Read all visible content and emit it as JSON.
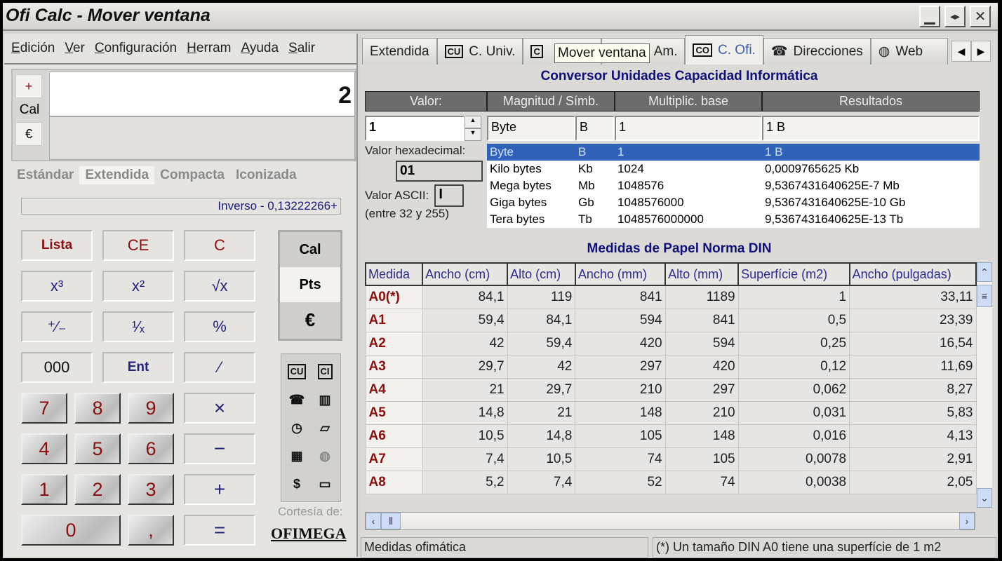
{
  "window": {
    "title": "Ofi Calc - Mover ventana",
    "controls": [
      "minimize",
      "restore",
      "close"
    ]
  },
  "menu": [
    {
      "label": "Edición",
      "key": "E"
    },
    {
      "label": "Ver",
      "key": "V"
    },
    {
      "label": "Configuración",
      "key": "C"
    },
    {
      "label": "Herram",
      "key": "H"
    },
    {
      "label": "Ayuda",
      "key": "A"
    },
    {
      "label": "Salir",
      "key": "S"
    }
  ],
  "calc": {
    "side": {
      "plus": "+",
      "cal": "Cal",
      "euro": "€"
    },
    "display": "2",
    "modes": [
      "Estándar",
      "Extendida",
      "Compacta",
      "Iconizada"
    ],
    "active_mode": "Extendida",
    "inverse": "Inverso - 0,13222266+",
    "func_keys": [
      "Lista",
      "CE",
      "C",
      "x³",
      "x²",
      "√x",
      "⁺∕₋",
      "¹∕ₓ",
      "%",
      "000",
      "Ent",
      "⁄"
    ],
    "ops": [
      "×",
      "−",
      "+",
      "="
    ],
    "digits": [
      "7",
      "8",
      "9",
      "4",
      "5",
      "6",
      "1",
      "2",
      "3",
      "0",
      ","
    ],
    "currency": [
      "Cal",
      "Pts",
      "€"
    ],
    "tools": [
      "CU",
      "CI",
      "phone",
      "book",
      "clock",
      "folder-hand",
      "calendar",
      "globe",
      "$",
      "open-folder"
    ],
    "courtesy": "Cortesía de:",
    "logo": "OFIMEGA"
  },
  "tabs": [
    {
      "label": "Extendida"
    },
    {
      "label": "C. Univ.",
      "icon": "CU"
    },
    {
      "label": "C. I",
      "icon": "C"
    },
    {
      "label": "C. Am."
    },
    {
      "label": "C. Ofi.",
      "icon": "CO",
      "active": true
    },
    {
      "label": "Direcciones",
      "icon": "phone"
    },
    {
      "label": "Web",
      "icon": "globe"
    }
  ],
  "tooltip": "Mover ventana",
  "converter": {
    "title": "Conversor Unidades Capacidad Informática",
    "headers": [
      "Valor:",
      "Magnitud / Símb.",
      "",
      "Multiplic. base",
      "Resultados"
    ],
    "value": "1",
    "current": {
      "unit": "Byte",
      "symbol": "B",
      "base": "1",
      "result": "1 B"
    },
    "hex_label": "Valor hexadecimal:",
    "hex": "01",
    "ascii_label": "Valor ASCII:",
    "ascii": "",
    "ascii_range": "(entre 32 y 255)",
    "units": [
      {
        "name": "Byte",
        "symbol": "B",
        "base": "1",
        "result": "1 B",
        "selected": true
      },
      {
        "name": "Kilo bytes",
        "symbol": "Kb",
        "base": "1024",
        "result": "0,0009765625 Kb"
      },
      {
        "name": "Mega bytes",
        "symbol": "Mb",
        "base": "1048576",
        "result": "9,5367431640625E-7 Mb"
      },
      {
        "name": "Giga bytes",
        "symbol": "Gb",
        "base": "1048576000",
        "result": "9,5367431640625E-10 Gb"
      },
      {
        "name": "Tera bytes",
        "symbol": "Tb",
        "base": "1048576000000",
        "result": "9,5367431640625E-13 Tb"
      }
    ]
  },
  "paper": {
    "title": "Medidas de Papel Norma DIN",
    "columns": [
      "Medida",
      "Ancho (cm)",
      "Alto (cm)",
      "Ancho (mm)",
      "Alto (mm)",
      "Superfície (m2)",
      "Ancho (pulgadas)"
    ],
    "rows": [
      [
        "A0(*)",
        "84,1",
        "119",
        "841",
        "1189",
        "1",
        "33,11"
      ],
      [
        "A1",
        "59,4",
        "84,1",
        "594",
        "841",
        "0,5",
        "23,39"
      ],
      [
        "A2",
        "42",
        "59,4",
        "420",
        "594",
        "0,25",
        "16,54"
      ],
      [
        "A3",
        "29,7",
        "42",
        "297",
        "420",
        "0,12",
        "11,69"
      ],
      [
        "A4",
        "21",
        "29,7",
        "210",
        "297",
        "0,062",
        "8,27"
      ],
      [
        "A5",
        "14,8",
        "21",
        "148",
        "210",
        "0,031",
        "5,83"
      ],
      [
        "A6",
        "10,5",
        "14,8",
        "105",
        "148",
        "0,016",
        "4,13"
      ],
      [
        "A7",
        "7,4",
        "10,5",
        "74",
        "105",
        "0,0078",
        "2,91"
      ],
      [
        "A8",
        "5,2",
        "7,4",
        "52",
        "74",
        "0,0038",
        "2,05"
      ]
    ]
  },
  "status": {
    "left": "Medidas ofimática",
    "right": "(*) Un tamaño DIN A0 tiene una superfície de 1 m2"
  }
}
